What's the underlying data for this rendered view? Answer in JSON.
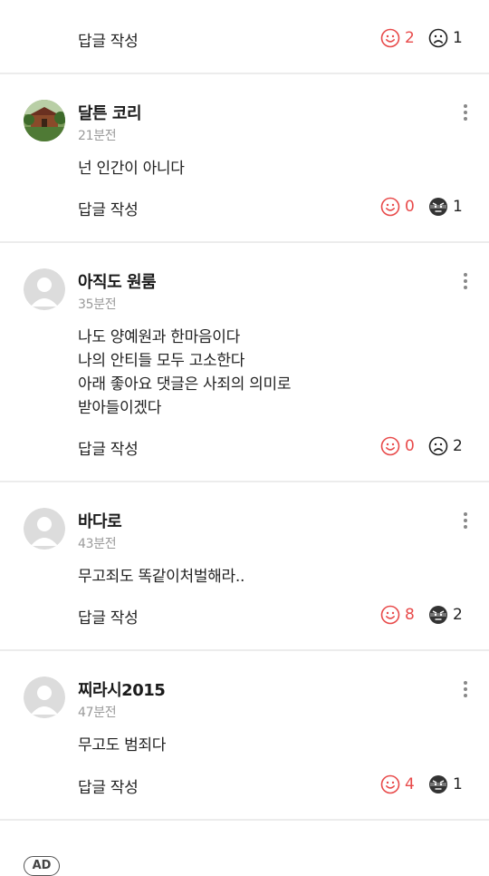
{
  "top_partial": {
    "reply_label": "답글 작성",
    "likes": "2",
    "dislikes": "1",
    "dislike_icon": "sad-face-icon"
  },
  "comments": [
    {
      "author": "달튼 코리",
      "time": "21분전",
      "lines": [
        "넌  인간이 아니다"
      ],
      "reply_label": "답글 작성",
      "likes": "0",
      "dislikes": "1",
      "avatar": "photo",
      "dislike_icon": "angry-face-icon"
    },
    {
      "author": "아직도 원룸",
      "time": "35분전",
      "lines": [
        "나도 양예원과 한마음이다",
        "나의 안티들 모두 고소한다",
        "아래 좋아요 댓글은 사죄의 의미로",
        "받아들이겠다"
      ],
      "reply_label": "답글 작성",
      "likes": "0",
      "dislikes": "2",
      "avatar": "default",
      "dislike_icon": "sad-face-icon"
    },
    {
      "author": "바다로",
      "time": "43분전",
      "lines": [
        "무고죄도 똑같이처벌해라.."
      ],
      "reply_label": "답글 작성",
      "likes": "8",
      "dislikes": "2",
      "avatar": "default",
      "dislike_icon": "angry-face-icon"
    },
    {
      "author": "찌라시2015",
      "time": "47분전",
      "lines": [
        "무고도 범죄다"
      ],
      "reply_label": "답글 작성",
      "likes": "4",
      "dislikes": "1",
      "avatar": "default",
      "dislike_icon": "angry-face-icon"
    }
  ],
  "ad_label": "AD",
  "colors": {
    "like": "#e84a4a",
    "divider": "#ececec",
    "time": "#9a9a9a"
  }
}
